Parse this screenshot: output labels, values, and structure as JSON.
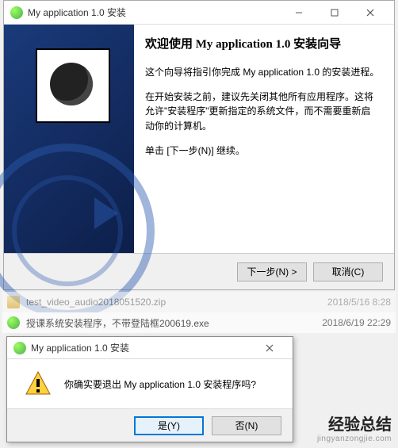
{
  "main": {
    "title": "My application 1.0 安装",
    "heading": "欢迎使用 My application 1.0 安装向导",
    "para1": "这个向导将指引你完成 My application 1.0 的安装进程。",
    "para2": "在开始安装之前，建议先关闭其他所有应用程序。这将允许\"安装程序\"更新指定的系统文件，而不需要重新启动你的计算机。",
    "para3": "单击 [下一步(N)] 继续。",
    "next": "下一步(N) >",
    "cancel": "取消(C)"
  },
  "files": {
    "f1_name": "test_video_audio2018051520.zip",
    "f1_date": "2018/5/16 8:28",
    "f2_name": "授课系统安装程序，不带登陆框200619.exe",
    "f2_date": "2018/6/19 22:29"
  },
  "dialog": {
    "title": "My application 1.0 安装",
    "message": "你确实要退出 My application 1.0 安装程序吗?",
    "yes": "是(Y)",
    "no": "否(N)"
  },
  "wm": {
    "big": "经验总结",
    "small": "jingyanzongjie.com"
  }
}
